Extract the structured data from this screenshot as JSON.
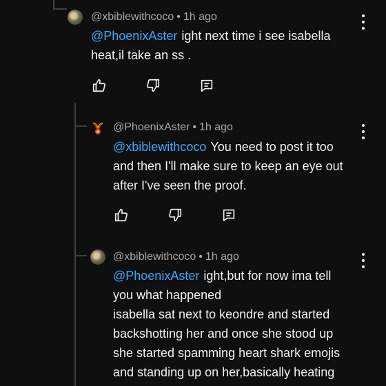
{
  "comments": [
    {
      "author": "@xbiblewithcoco",
      "time": "1h ago",
      "separator": "•",
      "mention": "@PhoenixAster",
      "text_first": "ight next time i see isabella",
      "text_rest": [
        "heat,il take an ss ."
      ]
    },
    {
      "author": "@PhoenixAster",
      "time": "1h ago",
      "separator": "•",
      "mention": "@xbiblewithcoco",
      "text_first": "You need to post it too",
      "text_rest": [
        "and then I'll make sure to keep an eye out",
        "after I've seen the proof."
      ]
    },
    {
      "author": "@xbiblewithcoco",
      "time": "1h ago",
      "separator": "•",
      "mention": "@PhoenixAster",
      "text_first": "ight,but for now ima tell",
      "text_rest": [
        "you what happened",
        "isabella sat next to keondre and started",
        "backshotting her and once she stood up",
        "she started spamming heart shark emojis",
        "and standing up on her,basically heating"
      ]
    }
  ],
  "colors": {
    "background": "#0f0f0f",
    "mention": "#3ea6ff",
    "meta": "#aaaaaa",
    "text": "#f1f1f1",
    "thread_line": "#3f3f3f"
  },
  "icons": [
    "like-icon",
    "dislike-icon",
    "reply-icon",
    "more-options-icon"
  ]
}
